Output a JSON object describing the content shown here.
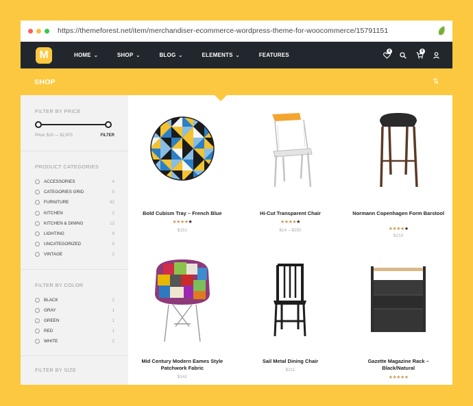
{
  "browser": {
    "url": "https://themeforest.net/item/merchandiser-ecommerce-wordpress-theme-for-woocommerce/15791151",
    "dot_colors": [
      "#FC605B",
      "#FDBC40",
      "#34C84A"
    ]
  },
  "nav": {
    "logo": "M",
    "items": [
      {
        "label": "HOME",
        "dropdown": true
      },
      {
        "label": "SHOP",
        "dropdown": true
      },
      {
        "label": "BLOG",
        "dropdown": true
      },
      {
        "label": "ELEMENTS",
        "dropdown": true
      },
      {
        "label": "FEATURES",
        "dropdown": false
      }
    ],
    "wishlist_count": "0",
    "cart_count": "0"
  },
  "shop": {
    "title": "SHOP"
  },
  "sidebar": {
    "price": {
      "title": "FILTER BY PRICE",
      "range_label": "Price: $10 — $2,970",
      "filter_label": "FILTER"
    },
    "categories": {
      "title": "PRODUCT CATEGORIES",
      "items": [
        {
          "name": "ACCESSORIES",
          "count": "4"
        },
        {
          "name": "CATEGORIES GRID",
          "count": "0"
        },
        {
          "name": "FURNITURE",
          "count": "42"
        },
        {
          "name": "KITCHEN",
          "count": "2"
        },
        {
          "name": "KITCHEN & DINING",
          "count": "12"
        },
        {
          "name": "LIGHTING",
          "count": "9"
        },
        {
          "name": "UNCATEGORIZED",
          "count": "0"
        },
        {
          "name": "VINTAGE",
          "count": "2"
        }
      ]
    },
    "colors": {
      "title": "FILTER BY COLOR",
      "items": [
        {
          "name": "BLACK",
          "count": "2"
        },
        {
          "name": "GRAY",
          "count": "1"
        },
        {
          "name": "GREEN",
          "count": "1"
        },
        {
          "name": "RED",
          "count": "1"
        },
        {
          "name": "WHITE",
          "count": "2"
        }
      ]
    },
    "size": {
      "title": "FILTER BY SIZE"
    }
  },
  "products": [
    {
      "name": "Bold Cubism Tray – French Blue",
      "price": "$151",
      "rating": 4
    },
    {
      "name": "Hi-Cut Transparent Chair",
      "price": "$14 – $250",
      "rating": 4
    },
    {
      "name": "Normann Copenhagen Form Barstool",
      "price": "$210",
      "rating": 4
    },
    {
      "name": "Mid Century Modern Eames Style Patchwork Fabric",
      "price": "$142",
      "rating": 0
    },
    {
      "name": "Sail Metal Dining Chair",
      "price": "$211",
      "rating": 0
    },
    {
      "name": "Gazette Magazine Rack – Black/Natural",
      "price": "",
      "rating": 5
    }
  ],
  "colors": {
    "accent": "#FCC83F",
    "nav_bg": "#22272E",
    "star": "#C69B5A"
  }
}
